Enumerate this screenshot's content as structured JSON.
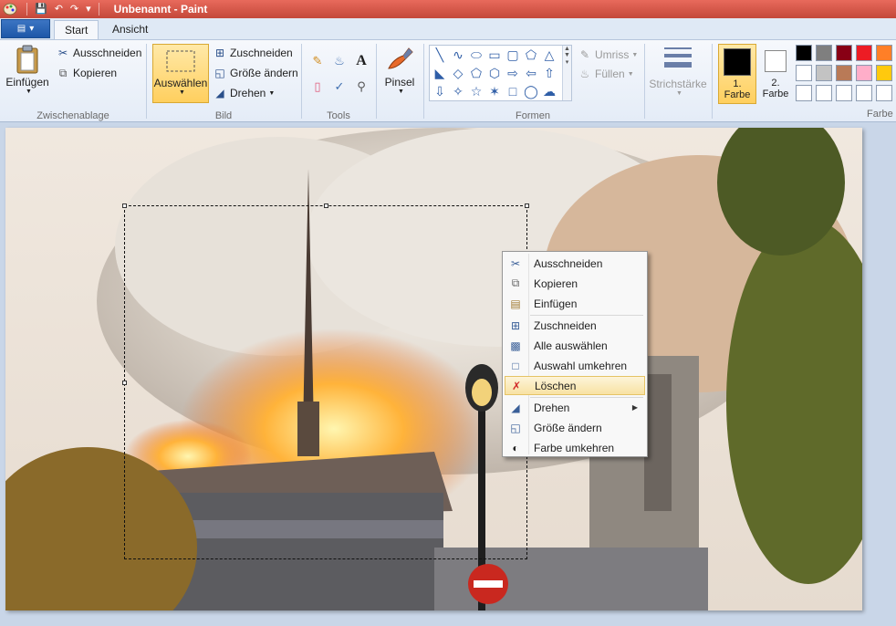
{
  "window": {
    "title": "Unbenannt - Paint"
  },
  "tabs": {
    "start": "Start",
    "view": "Ansicht"
  },
  "clipboard": {
    "paste": "Einfügen",
    "cut": "Ausschneiden",
    "copy": "Kopieren",
    "label": "Zwischenablage"
  },
  "image": {
    "select": "Auswählen",
    "crop": "Zuschneiden",
    "resize": "Größe ändern",
    "rotate": "Drehen",
    "label": "Bild"
  },
  "tools": {
    "label": "Tools"
  },
  "brushes": {
    "label": "Pinsel"
  },
  "shapes": {
    "outline": "Umriss",
    "fill": "Füllen",
    "label": "Formen"
  },
  "size": {
    "label": "Strichstärke"
  },
  "colors": {
    "color1_line1": "1.",
    "color1_line2": "Farbe",
    "color2_line1": "2.",
    "color2_line2": "Farbe",
    "label": "Farbe",
    "color1_value": "#000000",
    "color2_value": "#ffffff",
    "palette_row1": [
      "#000000",
      "#7f7f7f",
      "#880015",
      "#ed1c24",
      "#ff7f27"
    ],
    "palette_row2": [
      "#ffffff",
      "#c3c3c3",
      "#b97a57",
      "#ffaec9",
      "#ffc90e"
    ],
    "palette_row3": [
      "#ffffff",
      "#ffffff",
      "#ffffff",
      "#ffffff",
      "#ffffff"
    ]
  },
  "context_menu": {
    "items": [
      {
        "label": "Ausschneiden",
        "icon": "scissors-icon"
      },
      {
        "label": "Kopieren",
        "icon": "copy-icon"
      },
      {
        "label": "Einfügen",
        "icon": "paste-icon"
      },
      {
        "label": "Zuschneiden",
        "icon": "crop-icon"
      },
      {
        "label": "Alle auswählen",
        "icon": "select-all-icon"
      },
      {
        "label": "Auswahl umkehren",
        "icon": "invert-selection-icon"
      },
      {
        "label": "Löschen",
        "icon": "delete-icon"
      },
      {
        "label": "Drehen",
        "icon": "rotate-icon"
      },
      {
        "label": "Größe ändern",
        "icon": "resize-icon"
      },
      {
        "label": "Farbe umkehren",
        "icon": "invert-color-icon"
      }
    ],
    "highlighted": "Löschen"
  }
}
